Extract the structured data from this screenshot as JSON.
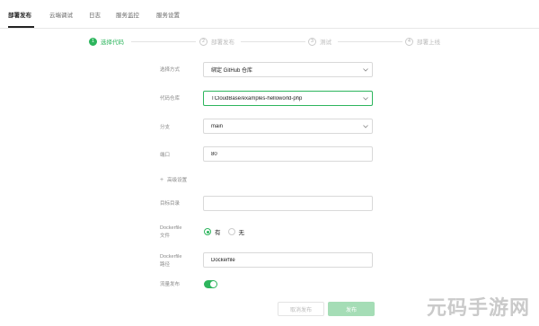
{
  "tabs": [
    {
      "label": "部署发布",
      "active": true
    },
    {
      "label": "云端调试",
      "active": false
    },
    {
      "label": "日志",
      "active": false
    },
    {
      "label": "服务监控",
      "active": false
    },
    {
      "label": "服务设置",
      "active": false
    }
  ],
  "steps": [
    {
      "num": "1",
      "label": "选择代码",
      "active": true
    },
    {
      "num": "2",
      "label": "部署发布",
      "active": false
    },
    {
      "num": "3",
      "label": "测试",
      "active": false
    },
    {
      "num": "4",
      "label": "部署上线",
      "active": false
    }
  ],
  "form": {
    "source_label": "选择方式",
    "source_value": "绑定 GitHub 仓库",
    "repo_label": "代码仓库",
    "repo_value": "TCloudBase/examples-helloworld-php",
    "branch_label": "分支",
    "branch_value": "main",
    "port_label": "端口",
    "port_value": "80",
    "advanced_label": "高级设置",
    "target_dir_label": "目标目录",
    "target_dir_value": "",
    "dockerfile_exists_label_1": "Dockerfile",
    "dockerfile_exists_label_2": "文件",
    "dockerfile_yes": "有",
    "dockerfile_no": "无",
    "dockerfile_path_label_1": "Dockerfile",
    "dockerfile_path_label_2": "路径",
    "dockerfile_path_value": "Dockerfile",
    "auto_publish_label": "流量发布",
    "auto_publish_on": true
  },
  "buttons": {
    "cancel": "取消发布",
    "publish": "发布"
  },
  "watermark": "元码手游网",
  "colors": {
    "accent": "#2db55d",
    "publish_disabled": "#a5ddb6"
  }
}
